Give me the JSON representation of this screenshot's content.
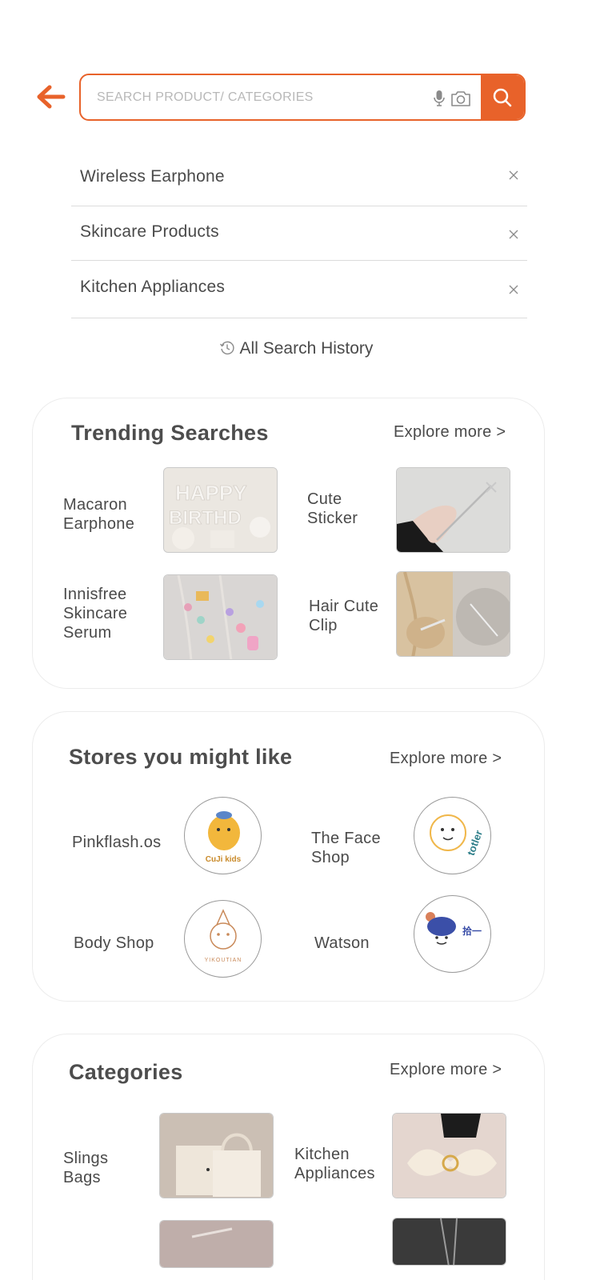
{
  "search": {
    "placeholder": "SEARCH PRODUCT/ CATEGORIES",
    "accent": "#e8622a"
  },
  "history": {
    "items": [
      {
        "label": "Wireless Earphone"
      },
      {
        "label": "Skincare Products"
      },
      {
        "label": "Kitchen Appliances"
      }
    ],
    "all_label": "All Search History"
  },
  "trending": {
    "title": "Trending Searches",
    "explore": "Explore more >",
    "items": [
      {
        "label": "Macaron Earphone",
        "image": "happy-birthday-balloons"
      },
      {
        "label": "Cute Sticker",
        "image": "silver-hairpin-hand"
      },
      {
        "label": "Innisfree Skincare Serum",
        "image": "beaded-charms"
      },
      {
        "label": "Hair Cute Clip",
        "image": "hair-clip-bun"
      }
    ]
  },
  "stores": {
    "title": "Stores you might like",
    "explore": "Explore more >",
    "items": [
      {
        "label": "Pinkflash.os",
        "logo_text": "CuJi kids"
      },
      {
        "label": "The Face Shop",
        "logo_text": "totler"
      },
      {
        "label": "Body Shop",
        "logo_text": "YIKOUTIAN"
      },
      {
        "label": "Watson",
        "logo_text": "拾一"
      }
    ]
  },
  "categories": {
    "title": "Categories",
    "explore": "Explore more >",
    "items": [
      {
        "label": "Slings Bags",
        "image": "beige-tote-bags"
      },
      {
        "label": "Kitchen Appliances",
        "image": "bow-hair-clips"
      }
    ]
  }
}
